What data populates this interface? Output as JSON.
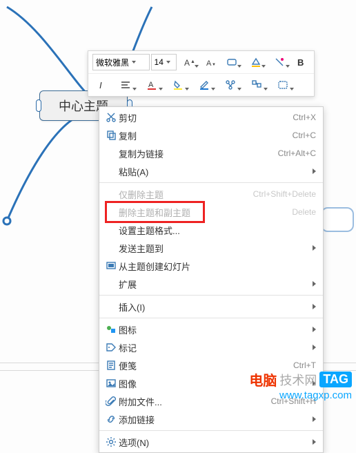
{
  "topic": {
    "label": "中心主题"
  },
  "toolbar": {
    "font_family": "微软雅黑",
    "font_size": "14"
  },
  "menu": {
    "cut": {
      "label": "剪切",
      "shortcut": "Ctrl+X"
    },
    "copy": {
      "label": "复制",
      "shortcut": "Ctrl+C"
    },
    "copy_as_link": {
      "label": "复制为链接",
      "shortcut": "Ctrl+Alt+C"
    },
    "paste": {
      "label": "粘贴(A)"
    },
    "delete_topic_only": {
      "label": "仅删除主题",
      "shortcut": "Ctrl+Shift+Delete"
    },
    "delete_topic_and_sub": {
      "label": "删除主题和副主题",
      "shortcut": "Delete"
    },
    "format_topic": {
      "label": "设置主题格式..."
    },
    "send_topic_to": {
      "label": "发送主题到"
    },
    "create_slide_from_topic": {
      "label": "从主题创建幻灯片"
    },
    "extensions": {
      "label": "扩展"
    },
    "insert": {
      "label": "插入(I)"
    },
    "icons": {
      "label": "图标"
    },
    "tags": {
      "label": "标记"
    },
    "notes": {
      "label": "便笺",
      "shortcut": "Ctrl+T"
    },
    "image": {
      "label": "图像"
    },
    "attachment": {
      "label": "附加文件...",
      "shortcut": "Ctrl+Shift+H"
    },
    "add_link": {
      "label": "添加链接"
    },
    "options": {
      "label": "选项(N)"
    }
  },
  "watermark": {
    "t1": "电脑",
    "t2": "技术网",
    "tag": "TAG",
    "url": "www.tagxp.com"
  },
  "colors": {
    "accent": "#3a7ab5",
    "highlight": "#e22"
  }
}
